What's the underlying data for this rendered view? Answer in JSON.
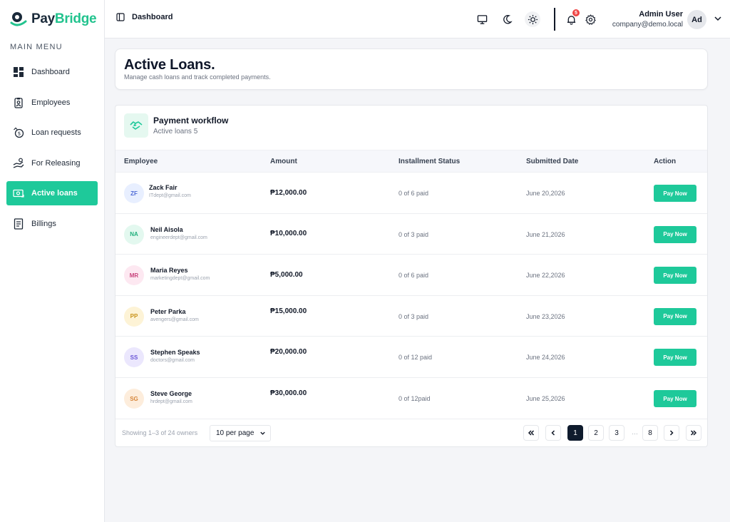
{
  "brand": {
    "pay": "Pay",
    "bridge": "Bridge"
  },
  "sidebar": {
    "section_title": "MAIN MENU",
    "items": [
      {
        "label": "Dashboard",
        "icon": "dashboard-icon"
      },
      {
        "label": "Employees",
        "icon": "id-badge-icon"
      },
      {
        "label": "Loan requests",
        "icon": "money-request-icon"
      },
      {
        "label": "For Releasing",
        "icon": "hand-money-icon"
      },
      {
        "label": "Active loans",
        "icon": "cash-icon",
        "active": true
      },
      {
        "label": "Billings",
        "icon": "invoice-icon"
      }
    ]
  },
  "header": {
    "breadcrumb": "Dashboard",
    "notification_count": "5",
    "user_name": "Admin User",
    "user_email": "company@demo.local",
    "avatar_initials": "Ad"
  },
  "page": {
    "title": "Active Loans.",
    "subtitle": "Manage cash loans and track completed payments."
  },
  "workflow": {
    "title": "Payment workflow",
    "subtitle": "Active loans 5"
  },
  "table": {
    "columns": [
      "Employee",
      "Amount",
      "Installment Status",
      "Submitted Date",
      "Action"
    ],
    "rows": [
      {
        "initials": "ZF",
        "name": "Zack Fair",
        "email": "ITdept@gmail.com",
        "amount": "₱12,000.00",
        "installment": "0 of 6 paid",
        "date": "June 20,2026",
        "action": "Pay Now"
      },
      {
        "initials": "NA",
        "name": "Neil Aisola",
        "email": "engineerdept@gmail.com",
        "amount": "₱10,000.00",
        "installment": "0 of 3 paid",
        "date": "June 21,2026",
        "action": "Pay Now"
      },
      {
        "initials": "MR",
        "name": "Maria Reyes",
        "email": "marketingdept@gmail.com",
        "amount": "₱5,000.00",
        "installment": "0 of 6 paid",
        "date": "June 22,2026",
        "action": "Pay Now"
      },
      {
        "initials": "PP",
        "name": "Peter Parka",
        "email": "avengers@gmail.com",
        "amount": "₱15,000.00",
        "installment": "0 of 3 paid",
        "date": "June 23,2026",
        "action": "Pay Now"
      },
      {
        "initials": "SS",
        "name": "Stephen Speaks",
        "email": "doctors@gmail.com",
        "amount": "₱20,000.00",
        "installment": "0 of 12 paid",
        "date": "June 24,2026",
        "action": "Pay Now"
      },
      {
        "initials": "SG",
        "name": "Steve George",
        "email": "hrdept@gmail.com",
        "amount": "₱30,000.00",
        "installment": "0 of 12paid",
        "date": "June 25,2026",
        "action": "Pay Now"
      }
    ]
  },
  "footer": {
    "showing": "Showing 1–3 of 24 owners",
    "per_page": "10 per page",
    "pages": [
      "1",
      "2",
      "3",
      "8"
    ],
    "ellipsis": "…",
    "current_page": "1"
  },
  "colors": {
    "accent": "#1ec99a",
    "navy": "#0f1b2d",
    "badge": "#ef4444"
  }
}
